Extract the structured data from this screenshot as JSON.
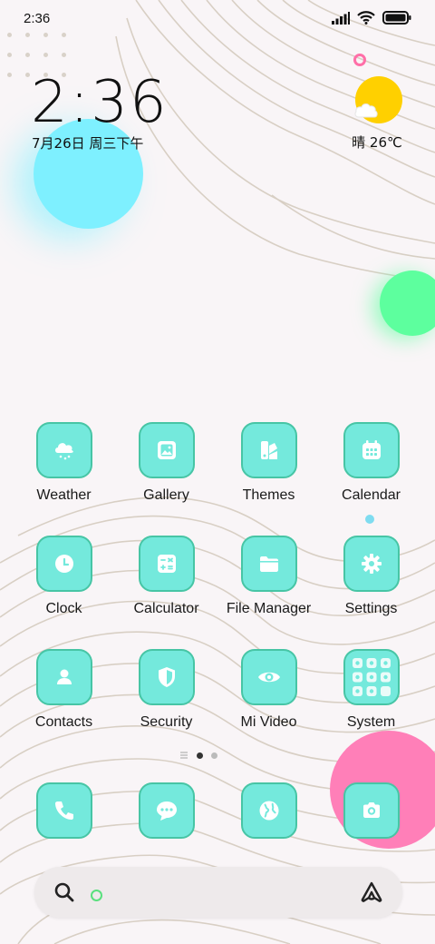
{
  "status_bar": {
    "time": "2:36"
  },
  "lockclock": {
    "time": "2:36",
    "date": "7月26日 周三下午"
  },
  "weather": {
    "text": "晴 26℃"
  },
  "colors": {
    "tile": "#74e9dc",
    "tile_border": "#47c5a5",
    "blob_blue": "#7ef0ff",
    "blob_green": "#5dff9e",
    "blob_pink": "#ff7fb8",
    "sun": "#ffd000"
  },
  "apps": [
    {
      "label": "Weather",
      "icon": "cloud-rain-icon"
    },
    {
      "label": "Gallery",
      "icon": "image-icon"
    },
    {
      "label": "Themes",
      "icon": "palette-icon"
    },
    {
      "label": "Calendar",
      "icon": "calendar-icon"
    },
    {
      "label": "Clock",
      "icon": "clock-icon"
    },
    {
      "label": "Calculator",
      "icon": "calculator-icon"
    },
    {
      "label": "File Manager",
      "icon": "folder-icon"
    },
    {
      "label": "Settings",
      "icon": "gear-icon"
    },
    {
      "label": "Contacts",
      "icon": "person-icon"
    },
    {
      "label": "Security",
      "icon": "shield-icon"
    },
    {
      "label": "Mi Video",
      "icon": "eye-icon"
    },
    {
      "label": "System",
      "icon": "folder-grid-icon"
    }
  ],
  "dock": [
    {
      "icon": "phone-icon"
    },
    {
      "icon": "message-icon"
    },
    {
      "icon": "globe-icon"
    },
    {
      "icon": "camera-icon"
    }
  ],
  "page_indicator": {
    "count": 2,
    "active": 0
  }
}
